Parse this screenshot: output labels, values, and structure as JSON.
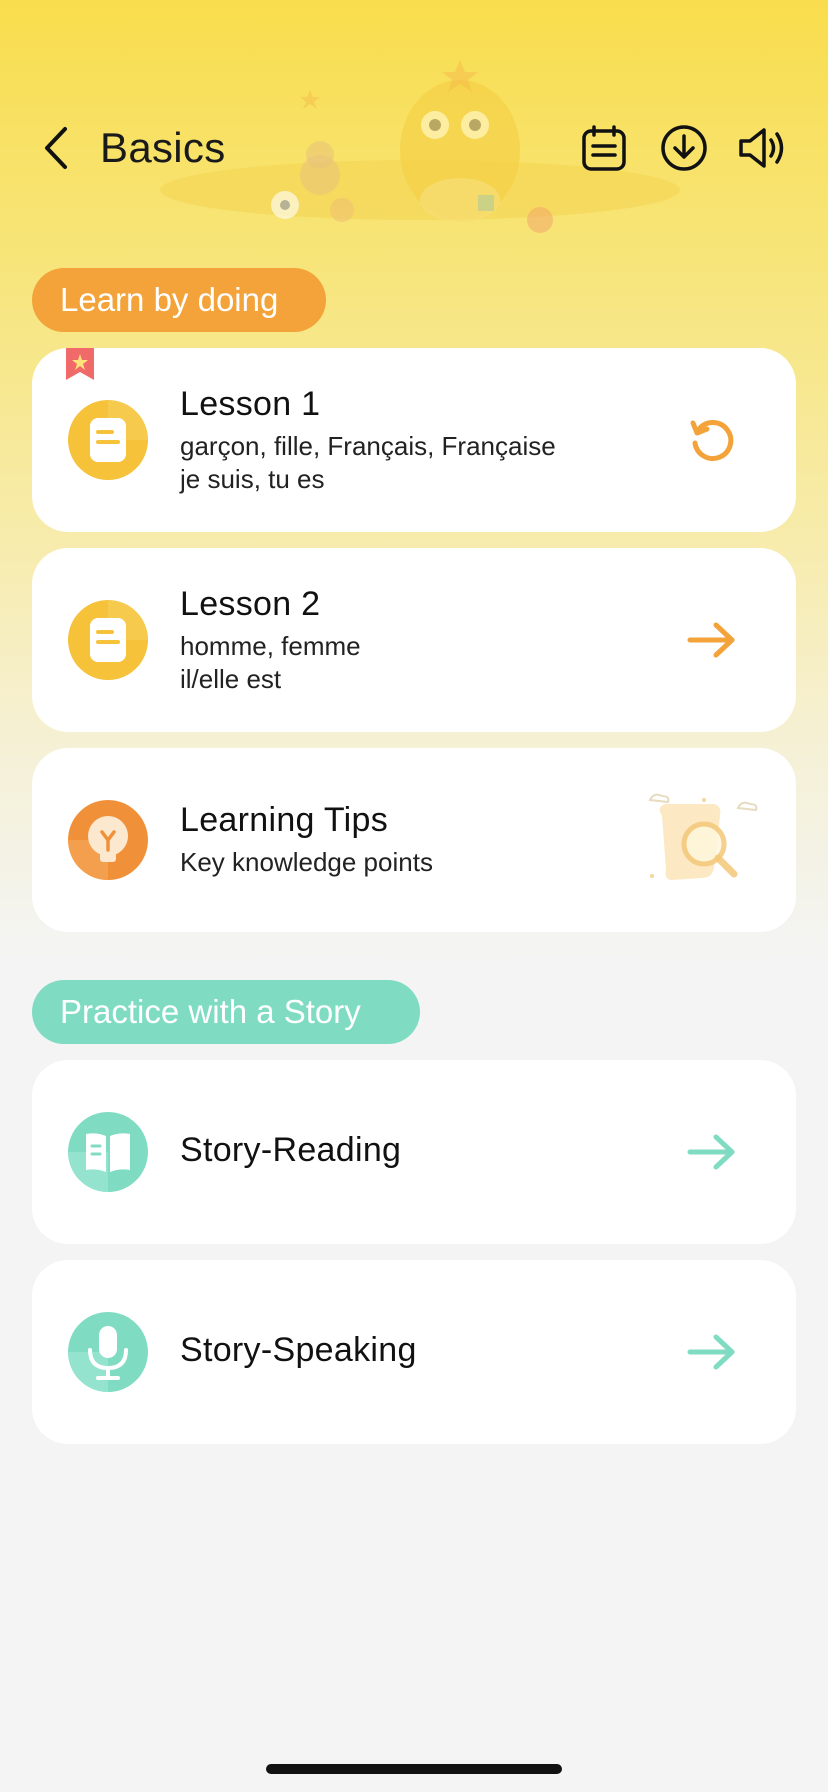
{
  "header": {
    "title": "Basics"
  },
  "icons": {
    "back": "chevron-left-icon",
    "notes": "notepad-icon",
    "download": "download-circle-icon",
    "sound": "speaker-icon"
  },
  "sections": {
    "learn": {
      "label": "Learn by doing",
      "color": "#f3a33a"
    },
    "practice": {
      "label": "Practice with a Story",
      "color": "#7fdcc2"
    }
  },
  "lessons": [
    {
      "title": "Lesson 1",
      "subtitle": "garçon, fille, Français, Française\nje suis, tu es",
      "action": "replay-icon",
      "bookmarked": true
    },
    {
      "title": "Lesson 2",
      "subtitle": "homme, femme\nil/elle est",
      "action": "arrow-right-icon",
      "bookmarked": false
    }
  ],
  "tips": {
    "title": "Learning Tips",
    "subtitle": "Key knowledge points"
  },
  "stories": [
    {
      "title": "Story-Reading",
      "icon": "book-icon",
      "action": "arrow-right-icon"
    },
    {
      "title": "Story-Speaking",
      "icon": "microphone-icon",
      "action": "arrow-right-icon"
    }
  ],
  "colors": {
    "accent_orange": "#f3a33a",
    "accent_yellow": "#f5c23a",
    "accent_green": "#7fdcc2",
    "tips_orange": "#f0913a"
  }
}
